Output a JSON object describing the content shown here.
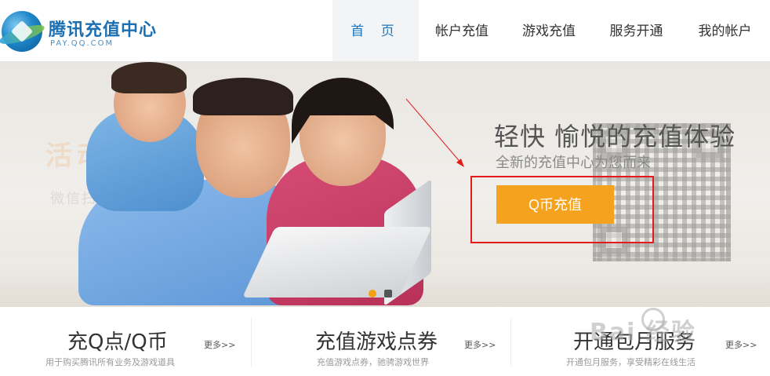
{
  "header": {
    "logo_title": "腾讯充值中心",
    "logo_sub": "PAY.QQ.COM",
    "nav": [
      {
        "label": "首 页",
        "active": true
      },
      {
        "label": "帐户充值",
        "active": false
      },
      {
        "label": "游戏充值",
        "active": false
      },
      {
        "label": "服务开通",
        "active": false
      },
      {
        "label": "我的帐户",
        "active": false
      }
    ]
  },
  "banner": {
    "headline": "轻快 愉悦的充值体验",
    "subline": "全新的充值中心为您而来",
    "cta_label": "Q币充值",
    "bg_text": "活动惊喜",
    "bg_text2": "微信扫扫加关注 ... 00 Q币",
    "carousel": {
      "count": 2,
      "active_index": 0
    },
    "colors": {
      "cta": "#f5a21f",
      "highlight": "#e31b1b",
      "accent": "#1a78c2"
    }
  },
  "cards": [
    {
      "title": "充Q点/Q币",
      "more": "更多>>",
      "desc": "用于购买腾讯所有业务及游戏道具"
    },
    {
      "title": "充值游戏点券",
      "more": "更多>>",
      "desc": "充值游戏点券，驰骋游戏世界"
    },
    {
      "title": "开通包月服务",
      "more": "更多>>",
      "desc": "开通包月服务，享受精彩在线生活"
    }
  ],
  "watermark": "Bai 经验"
}
